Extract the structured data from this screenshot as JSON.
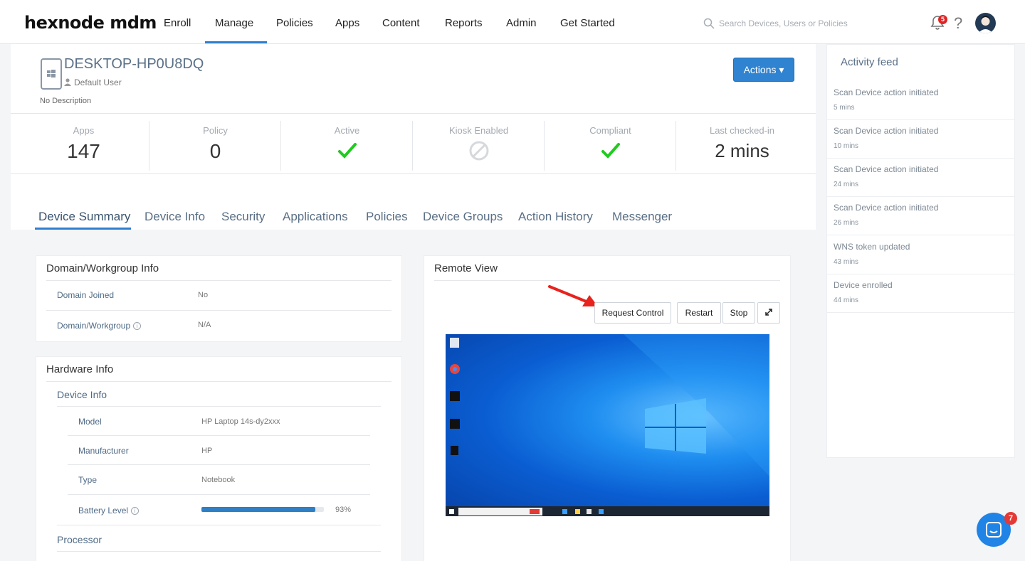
{
  "app": {
    "logo_text": "hexnode mdm"
  },
  "nav": {
    "items": [
      "Enroll",
      "Manage",
      "Policies",
      "Apps",
      "Content",
      "Reports",
      "Admin",
      "Get Started"
    ],
    "active": "Manage",
    "search_placeholder": "Search Devices, Users or Policies",
    "notification_count": "5",
    "help_label": "?"
  },
  "device": {
    "name": "DESKTOP-HP0U8DQ",
    "user": "Default User",
    "description": "No Description",
    "actions_label": "Actions ▾"
  },
  "stats": {
    "apps": {
      "label": "Apps",
      "value": "147"
    },
    "policy": {
      "label": "Policy",
      "value": "0"
    },
    "active": {
      "label": "Active",
      "state": "check"
    },
    "kiosk": {
      "label": "Kiosk Enabled",
      "state": "disabled"
    },
    "compliant": {
      "label": "Compliant",
      "state": "check"
    },
    "last_checked": {
      "label": "Last checked-in",
      "value": "2 mins"
    }
  },
  "tabs": [
    "Device Summary",
    "Device Info",
    "Security",
    "Applications",
    "Policies",
    "Device Groups",
    "Action History",
    "Messenger"
  ],
  "active_tab": "Device Summary",
  "domain_panel": {
    "title": "Domain/Workgroup Info",
    "rows": [
      {
        "label": "Domain Joined",
        "value": "No"
      },
      {
        "label": "Domain/Workgroup",
        "value": "N/A"
      }
    ]
  },
  "hardware_panel": {
    "title": "Hardware Info",
    "device_info_heading": "Device Info",
    "rows": [
      {
        "label": "Model",
        "value": "HP Laptop 14s-dy2xxx"
      },
      {
        "label": "Manufacturer",
        "value": "HP"
      },
      {
        "label": "Type",
        "value": "Notebook"
      }
    ],
    "battery": {
      "label": "Battery Level",
      "value": "93%",
      "fraction": 0.93
    },
    "processor_heading": "Processor"
  },
  "remote_view": {
    "title": "Remote View",
    "buttons": {
      "request_control": "Request Control",
      "restart": "Restart",
      "stop": "Stop"
    }
  },
  "activity_feed": {
    "title": "Activity feed",
    "items": [
      {
        "text": "Scan Device action initiated",
        "time": "5 mins"
      },
      {
        "text": "Scan Device action initiated",
        "time": "10 mins"
      },
      {
        "text": "Scan Device action initiated",
        "time": "24 mins"
      },
      {
        "text": "Scan Device action initiated",
        "time": "26 mins"
      },
      {
        "text": "WNS token updated",
        "time": "43 mins"
      },
      {
        "text": "Device enrolled",
        "time": "44 mins"
      }
    ]
  },
  "chat": {
    "badge": "7"
  },
  "colors": {
    "accent": "#2f7fd1",
    "check": "#1ecb1e",
    "arrow": "#e8221c"
  }
}
